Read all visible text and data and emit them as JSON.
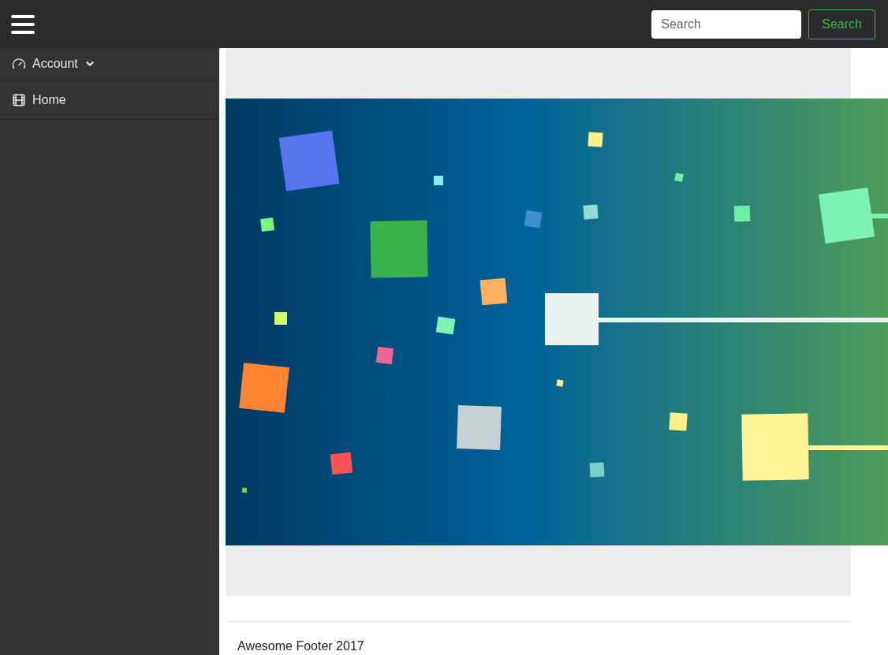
{
  "search": {
    "placeholder": "Search",
    "button": "Search"
  },
  "sidebar": {
    "items": [
      {
        "kind": "dropdown",
        "label": "Account"
      },
      {
        "kind": "link",
        "label": "Home"
      }
    ]
  },
  "footer": {
    "text": "Awesome Footer 2017"
  }
}
